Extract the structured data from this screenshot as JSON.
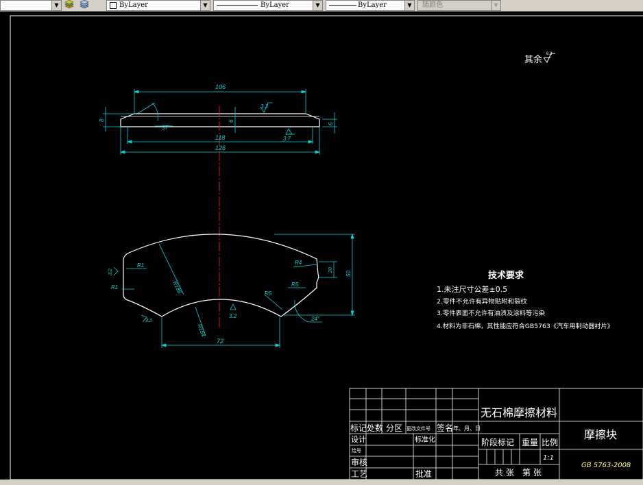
{
  "toolbar": {
    "color_combo": "ByLayer",
    "linetype_combo": "ByLayer",
    "lineweight_combo": "ByLayer",
    "plotstyle_combo": "随颜色"
  },
  "drawing": {
    "roughness_note": "其余",
    "roughness_note_value": "6.3",
    "top_view": {
      "dim_top_width": "106",
      "dim_mid_width": "118",
      "dim_bottom_width": "126",
      "dim_height_left": "8",
      "dim_height_mid": "6",
      "dim_height_right": "6",
      "angle": "37°",
      "roughness_top": "3.2",
      "roughness_bottom": "3.7"
    },
    "front_view": {
      "radius_r1_upper": "R1",
      "radius_r1_lower": "R1",
      "radius_large": "R186",
      "radius_lower": "R154",
      "radius_r4": "R4",
      "radius_r5_a": "R5",
      "radius_r5_b": "R5",
      "dim_notch": "20",
      "dim_height": "50",
      "dim_bottom_width": "72",
      "angle": "24°",
      "roughness_left": "3.2",
      "roughness_bottom_left": "3.2",
      "roughness_bottom": "3.2"
    },
    "tech_requirements": {
      "title": "技术要求",
      "items": [
        "1.未注尺寸公差±0.5",
        "2.零件不允许有异物贴附和裂纹",
        "3.零件表面不允许有油渍及涂料等污染",
        "4.材料为非石棉，其性能应符合GB5763《汽车用制动器衬片》"
      ]
    }
  },
  "title_block": {
    "material": "无石棉摩擦材料",
    "part_name": "摩擦块",
    "standard": "GB 5763-2008",
    "labels": {
      "mark": "标记",
      "count": "处数",
      "zone": "分区",
      "change_doc": "更改文件号",
      "signature": "签名",
      "date": "年、月、日",
      "design": "设计",
      "standardization": "标准化",
      "drawer": "绘号",
      "review": "审核",
      "process": "工艺",
      "approve": "批准",
      "stage_mark": "阶段标记",
      "weight": "重量",
      "scale": "比例",
      "scale_value": "1:1",
      "total_sheets": "共 张",
      "sheet_no": "第 张"
    }
  }
}
